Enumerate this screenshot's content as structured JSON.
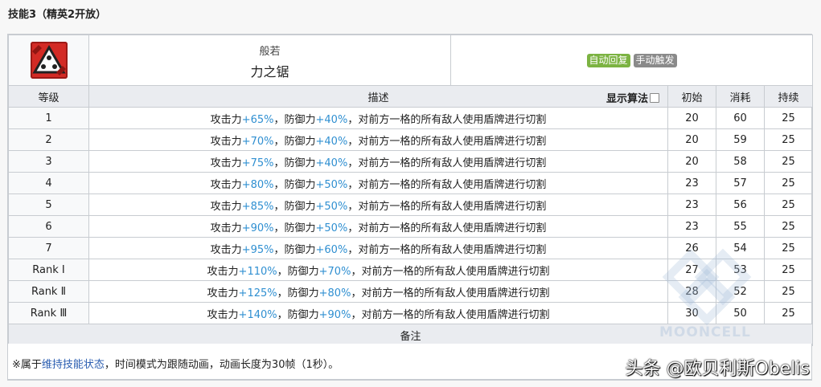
{
  "section_title": "技能3（精英2开放）",
  "skill": {
    "icon": "saw-triangle-icon",
    "subname": "般若",
    "name": "力之锯",
    "tags": [
      {
        "label": "自动回复",
        "color": "#7cb342"
      },
      {
        "label": "手动触发",
        "color": "#8a8a8a"
      }
    ]
  },
  "columns": {
    "level": "等级",
    "description": "描述",
    "toggle_label": "显示算法",
    "initial": "初始",
    "cost": "消耗",
    "duration": "持续"
  },
  "rows": [
    {
      "level": "1",
      "atk": "+65%",
      "def": "+40%",
      "initial": "20",
      "cost": "60",
      "duration": "25"
    },
    {
      "level": "2",
      "atk": "+70%",
      "def": "+40%",
      "initial": "20",
      "cost": "59",
      "duration": "25"
    },
    {
      "level": "3",
      "atk": "+75%",
      "def": "+40%",
      "initial": "20",
      "cost": "58",
      "duration": "25"
    },
    {
      "level": "4",
      "atk": "+80%",
      "def": "+50%",
      "initial": "23",
      "cost": "57",
      "duration": "25"
    },
    {
      "level": "5",
      "atk": "+85%",
      "def": "+50%",
      "initial": "23",
      "cost": "56",
      "duration": "25"
    },
    {
      "level": "6",
      "atk": "+90%",
      "def": "+50%",
      "initial": "23",
      "cost": "55",
      "duration": "25"
    },
    {
      "level": "7",
      "atk": "+95%",
      "def": "+60%",
      "initial": "26",
      "cost": "54",
      "duration": "25"
    },
    {
      "level": "Rank Ⅰ",
      "atk": "+110%",
      "def": "+70%",
      "initial": "27",
      "cost": "53",
      "duration": "25"
    },
    {
      "level": "Rank Ⅱ",
      "atk": "+125%",
      "def": "+80%",
      "initial": "28",
      "cost": "52",
      "duration": "25"
    },
    {
      "level": "Rank Ⅲ",
      "atk": "+140%",
      "def": "+90%",
      "initial": "30",
      "cost": "50",
      "duration": "25"
    }
  ],
  "desc_parts": {
    "atk_label": "攻击力",
    "sep": "，",
    "def_label": "防御力",
    "rest": "，对前方一格的所有敌人使用盾牌进行切割"
  },
  "notes": {
    "header": "备注",
    "prefix": "※属于",
    "link": "维持技能状态",
    "suffix": "，时间模式为跟随动画，动画长度为30帧（1秒）。"
  },
  "watermark": "MOONCELL",
  "credit": "头条 @欧贝利斯Obelis"
}
